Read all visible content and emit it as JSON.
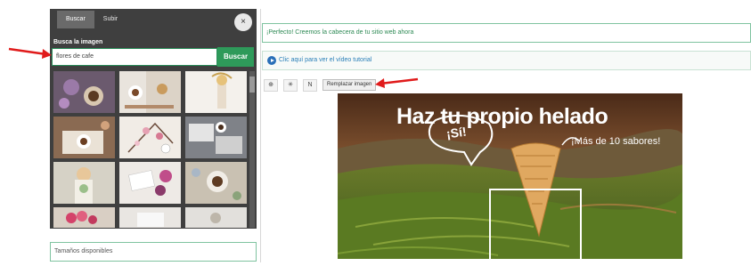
{
  "panel": {
    "tabs": [
      "Buscar",
      "Subir"
    ],
    "close_symbol": "×",
    "search_label": "Busca la imagen",
    "search_value": "flores de cafe",
    "search_button": "Buscar"
  },
  "sizes_label": "Tamaños disponibles",
  "success_message": "¡Perfecto! Creemos la cabecera de tu sitio web ahora",
  "video_link": "Clic aquí para ver el vídeo tutorial",
  "toolbar": {
    "buttons": [
      "⊕",
      "✳",
      "N"
    ],
    "replace_label": "Remplazar imagen"
  },
  "hero": {
    "title": "Haz tu propio helado",
    "badge": "¡Sí!",
    "subtitle": "¡Más de 10 sabores!"
  },
  "icons": {
    "close": "close-icon",
    "play": "play-circle-icon",
    "arrows": "red-arrow-icon"
  },
  "colors": {
    "accent_green": "#2e9a5a",
    "panel_bg": "#3f3f3f",
    "link_blue": "#2a7fb8",
    "arrow_red": "#e01b1b"
  }
}
